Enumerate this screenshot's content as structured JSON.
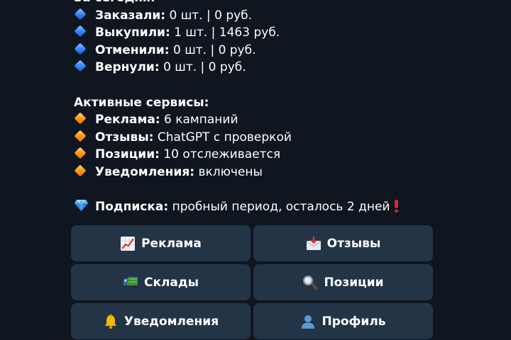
{
  "today": {
    "heading": "За сегодня:",
    "rows": [
      {
        "label": "Заказали:",
        "value": "0 шт. | 0 руб."
      },
      {
        "label": "Выкупили:",
        "value": "1 шт. | 1463 руб."
      },
      {
        "label": "Отменили:",
        "value": "0 шт. | 0 руб."
      },
      {
        "label": "Вернули:",
        "value": "0 шт. | 0 руб."
      }
    ]
  },
  "services": {
    "heading": "Активные сервисы:",
    "rows": [
      {
        "label": "Реклама:",
        "value": "6 кампаний"
      },
      {
        "label": "Отзывы:",
        "value": "ChatGPT с проверкой"
      },
      {
        "label": "Позиции:",
        "value": "10 отслеживается"
      },
      {
        "label": "Уведомления:",
        "value": "включены"
      }
    ]
  },
  "subscription": {
    "label": "Подписка:",
    "value": "пробный период, осталось 2 дней"
  },
  "keyboard": {
    "ads": "Реклама",
    "reviews": "Отзывы",
    "warehouses": "Склады",
    "positions": "Позиции",
    "notifications": "Уведомления",
    "profile": "Профиль"
  },
  "icons": {
    "today_bullet": "blue-diamond-icon",
    "services_bullet": "orange-diamond-icon",
    "subscription": "gem-icon",
    "alert": "red-exclamation-icon",
    "ads": "chart-increasing-icon",
    "reviews": "incoming-envelope-icon",
    "warehouses": "delivery-truck-icon",
    "positions": "magnifying-glass-icon",
    "notifications": "bell-icon",
    "profile": "user-silhouette-icon"
  }
}
